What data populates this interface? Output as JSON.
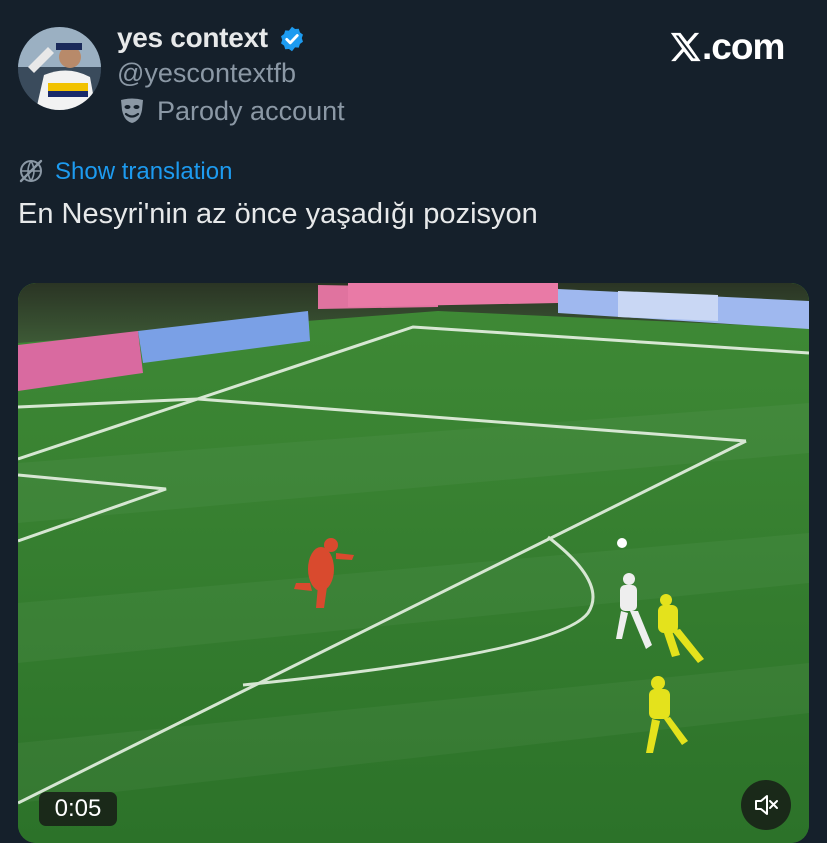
{
  "author": {
    "display_name": "yes context",
    "handle": "@yescontextfb",
    "parody_label": "Parody account",
    "verified": true
  },
  "brand": {
    "text": ".com"
  },
  "tweet": {
    "translate_label": "Show translation",
    "text": "En Nesyri'nin az önce yaşadığı pozisyon"
  },
  "video": {
    "timer": "0:05"
  },
  "colors": {
    "background": "#15202b",
    "link": "#1d9bf0",
    "verified": "#1d9bf0",
    "secondary_text": "#8b98a5",
    "pitch": "#2f7a2c"
  },
  "icons": [
    "verified-badge-icon",
    "parody-mask-icon",
    "x-logo-icon",
    "translate-globe-icon",
    "mute-speaker-icon"
  ]
}
